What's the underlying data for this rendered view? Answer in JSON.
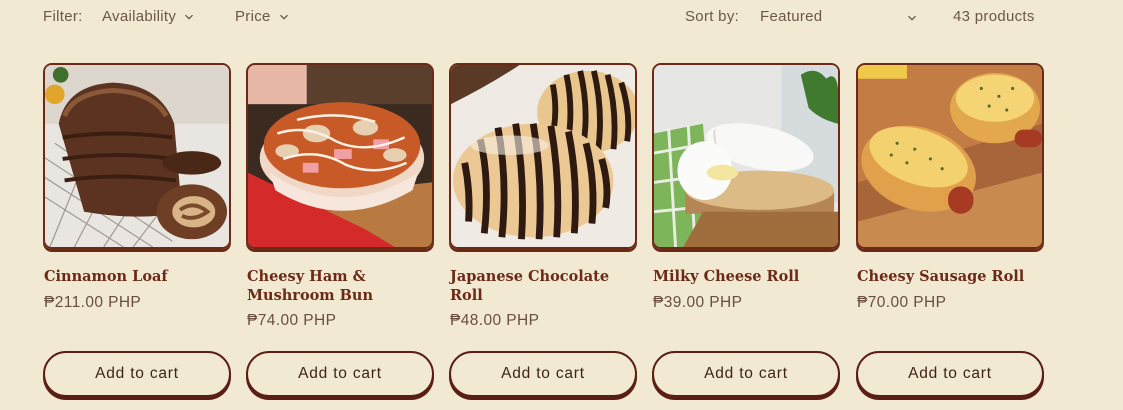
{
  "toolbar": {
    "filter_label": "Filter:",
    "availability_label": "Availability",
    "price_label": "Price",
    "sort_label": "Sort by:",
    "sort_value": "Featured",
    "product_count": "43 products"
  },
  "products": [
    {
      "title": "Cinnamon Loaf",
      "price": "₱211.00 PHP",
      "cta": "Add to cart"
    },
    {
      "title": "Cheesy Ham & Mushroom Bun",
      "price": "₱74.00 PHP",
      "cta": "Add to cart"
    },
    {
      "title": "Japanese Chocolate Roll",
      "price": "₱48.00 PHP",
      "cta": "Add to cart"
    },
    {
      "title": "Milky Cheese Roll",
      "price": "₱39.00 PHP",
      "cta": "Add to cart"
    },
    {
      "title": "Cheesy Sausage Roll",
      "price": "₱70.00 PHP",
      "cta": "Add to cart"
    }
  ],
  "colors": {
    "background": "#f1e9d1",
    "brand": "#6b2a17",
    "button_border": "#5a1e14",
    "text": "#6a4e40"
  }
}
